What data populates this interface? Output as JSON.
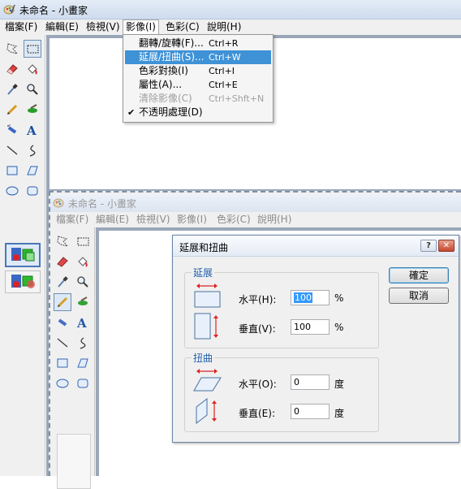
{
  "app": {
    "title": "未命名 - 小畫家"
  },
  "menu": {
    "items": [
      "檔案(F)",
      "編輯(E)",
      "檢視(V)",
      "影像(I)",
      "色彩(C)",
      "說明(H)"
    ]
  },
  "image_menu": {
    "items": [
      {
        "label": "翻轉/旋轉(F)...",
        "shortcut": "Ctrl+R"
      },
      {
        "label": "延展/扭曲(S)...",
        "shortcut": "Ctrl+W"
      },
      {
        "label": "色彩對換(I)",
        "shortcut": "Ctrl+I"
      },
      {
        "label": "屬性(A)...",
        "shortcut": "Ctrl+E"
      },
      {
        "label": "清除影像(C)",
        "shortcut": "Ctrl+Shft+N"
      },
      {
        "label": "不透明處理(D)",
        "shortcut": ""
      }
    ],
    "highlighted_index": 1,
    "disabled_index": 4,
    "checked_index": 5,
    "check_mark": "✔"
  },
  "toolbox": {
    "tools": [
      "free-select",
      "rect-select",
      "eraser",
      "fill-bucket",
      "eyedropper",
      "magnifier",
      "pencil",
      "brush",
      "airbrush",
      "text",
      "line",
      "curve",
      "rectangle",
      "polygon",
      "ellipse",
      "rounded-rect"
    ],
    "selected_tool": "rect-select",
    "inner_selected_tool": "pencil"
  },
  "dialog": {
    "title": "延展和扭曲",
    "help_label": "?",
    "close_label": "✕",
    "stretch": {
      "title": "延展",
      "horizontal_label": "水平(H):",
      "horizontal_value": "100",
      "horizontal_unit": "%",
      "vertical_label": "垂直(V):",
      "vertical_value": "100",
      "vertical_unit": "%"
    },
    "skew": {
      "title": "扭曲",
      "horizontal_label": "水平(O):",
      "horizontal_value": "0",
      "horizontal_unit": "度",
      "vertical_label": "垂直(E):",
      "vertical_value": "0",
      "vertical_unit": "度"
    },
    "ok_label": "確定",
    "cancel_label": "取消"
  },
  "colors": {
    "highlight": "#3f92d6",
    "group_title": "#1f5fae",
    "close_button": "#c9462d"
  }
}
